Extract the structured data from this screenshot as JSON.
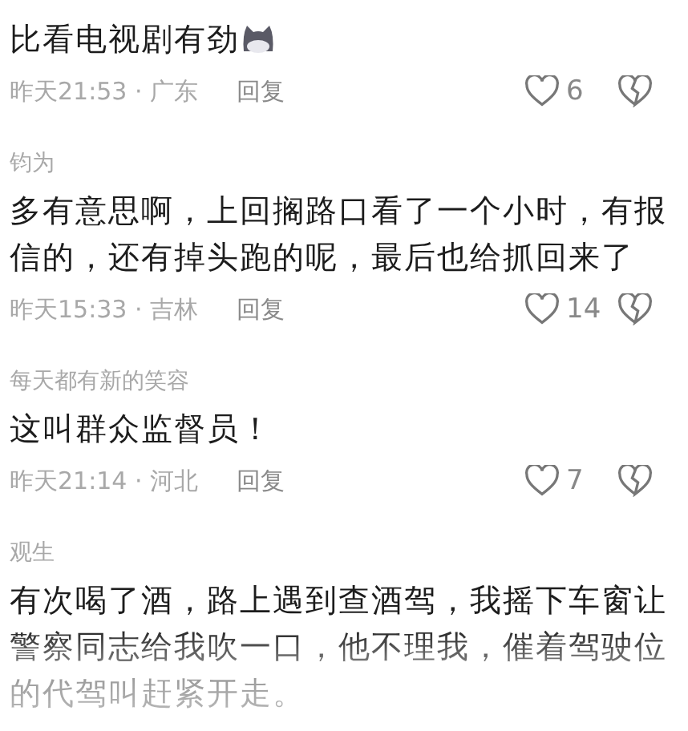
{
  "comments": [
    {
      "text": "比看电视剧有劲",
      "emoji": true,
      "meta": "昨天21:53 · 广东",
      "reply": "回复",
      "likes": "6"
    },
    {
      "username": "钧为",
      "text": "多有意思啊，上回搁路口看了一个小时，有报信的，还有掉头跑的呢，最后也给抓回来了",
      "meta": "昨天15:33 · 吉林",
      "reply": "回复",
      "likes": "14"
    },
    {
      "username": "每天都有新的笑容",
      "text": "这叫群众监督员！",
      "meta": "昨天21:14 · 河北",
      "reply": "回复",
      "likes": "7"
    },
    {
      "username": "观生",
      "text": "有次喝了酒，路上遇到查酒驾，我摇下车窗让警察同志给我吹一口，他不理我，催着驾驶位的代驾叫赶紧开走。",
      "faded": true
    }
  ]
}
